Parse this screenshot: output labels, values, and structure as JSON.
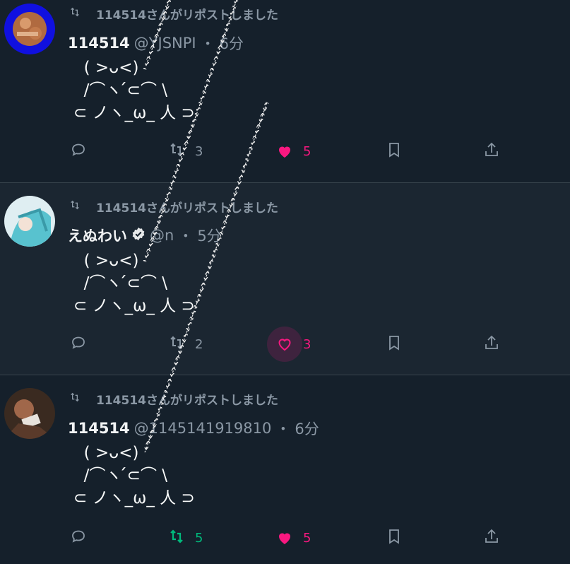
{
  "colors": {
    "accent_like": "#f91880",
    "accent_repost": "#00ba7c",
    "muted": "#8b98a5",
    "bg": "#15202b"
  },
  "ascii_art": {
    "line1": "  ( >ᴗ<)",
    "line2": "  /⌒ヽ ́́⊂⌒ \\",
    "line3": "⊂ ノヽ_ω_ 人 ⊃"
  },
  "tweets": [
    {
      "repost_text": "114514さんがリポストしました",
      "name": "114514",
      "handle": "@YJSNPI",
      "sep": "・",
      "time": "6分",
      "verified": false,
      "reply_icon": "reply-icon",
      "retweet_count": "3",
      "like_count": "5",
      "retweeted": false,
      "liked": true
    },
    {
      "repost_text": "114514さんがリポストしました",
      "name": "えぬわい",
      "handle": "@n",
      "sep": "・",
      "time": "5分",
      "verified": true,
      "reply_icon": "reply-icon",
      "retweet_count": "2",
      "like_count": "3",
      "retweeted": false,
      "liked": false
    },
    {
      "repost_text": "114514さんがリポストしました",
      "name": "114514",
      "handle": "@1145141919810",
      "sep": "・",
      "time": "6分",
      "verified": false,
      "reply_icon": "reply-icon",
      "retweet_count": "5",
      "like_count": "5",
      "retweeted": true,
      "liked": true
    }
  ]
}
